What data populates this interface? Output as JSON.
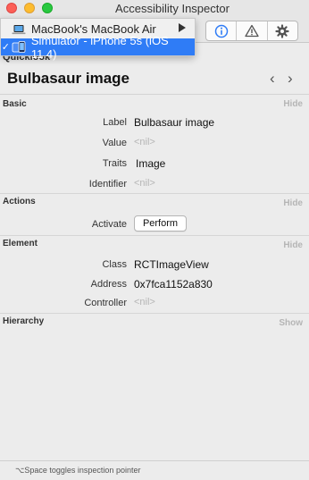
{
  "window": {
    "title": "Accessibility Inspector"
  },
  "target_menu": {
    "items": [
      {
        "label": "MacBook's MacBook Air",
        "checked": false,
        "has_submenu": true
      },
      {
        "label": "Simulator - iPhone 5s (iOS 11.4)",
        "checked": true,
        "selected": true
      }
    ]
  },
  "toolbar": {
    "tools": [
      "inspection-icon",
      "audit-icon",
      "settings-icon"
    ]
  },
  "quicklook": {
    "label": "Quicklook",
    "element_title": "Bulbasaur image",
    "prev": "‹",
    "next": "›"
  },
  "basic": {
    "title": "Basic",
    "toggle": "Hide",
    "rows": [
      {
        "label": "Label",
        "value": "Bulbasaur image"
      },
      {
        "label": "Value",
        "value": "<nil>"
      },
      {
        "label": "Traits",
        "value": "Image"
      },
      {
        "label": "Identifier",
        "value": "<nil>"
      }
    ]
  },
  "actions": {
    "title": "Actions",
    "toggle": "Hide",
    "rows": [
      {
        "label": "Activate",
        "button": "Perform"
      }
    ]
  },
  "element": {
    "title": "Element",
    "toggle": "Hide",
    "rows": [
      {
        "label": "Class",
        "value": "RCTImageView"
      },
      {
        "label": "Address",
        "value": "0x7fca1152a830"
      },
      {
        "label": "Controller",
        "value": "<nil>"
      }
    ]
  },
  "hierarchy": {
    "title": "Hierarchy",
    "toggle": "Show"
  },
  "footer": {
    "hint": "⌥Space toggles inspection pointer"
  },
  "colors": {
    "selection": "#2f7cf6",
    "accent": "#2f7cf6"
  }
}
